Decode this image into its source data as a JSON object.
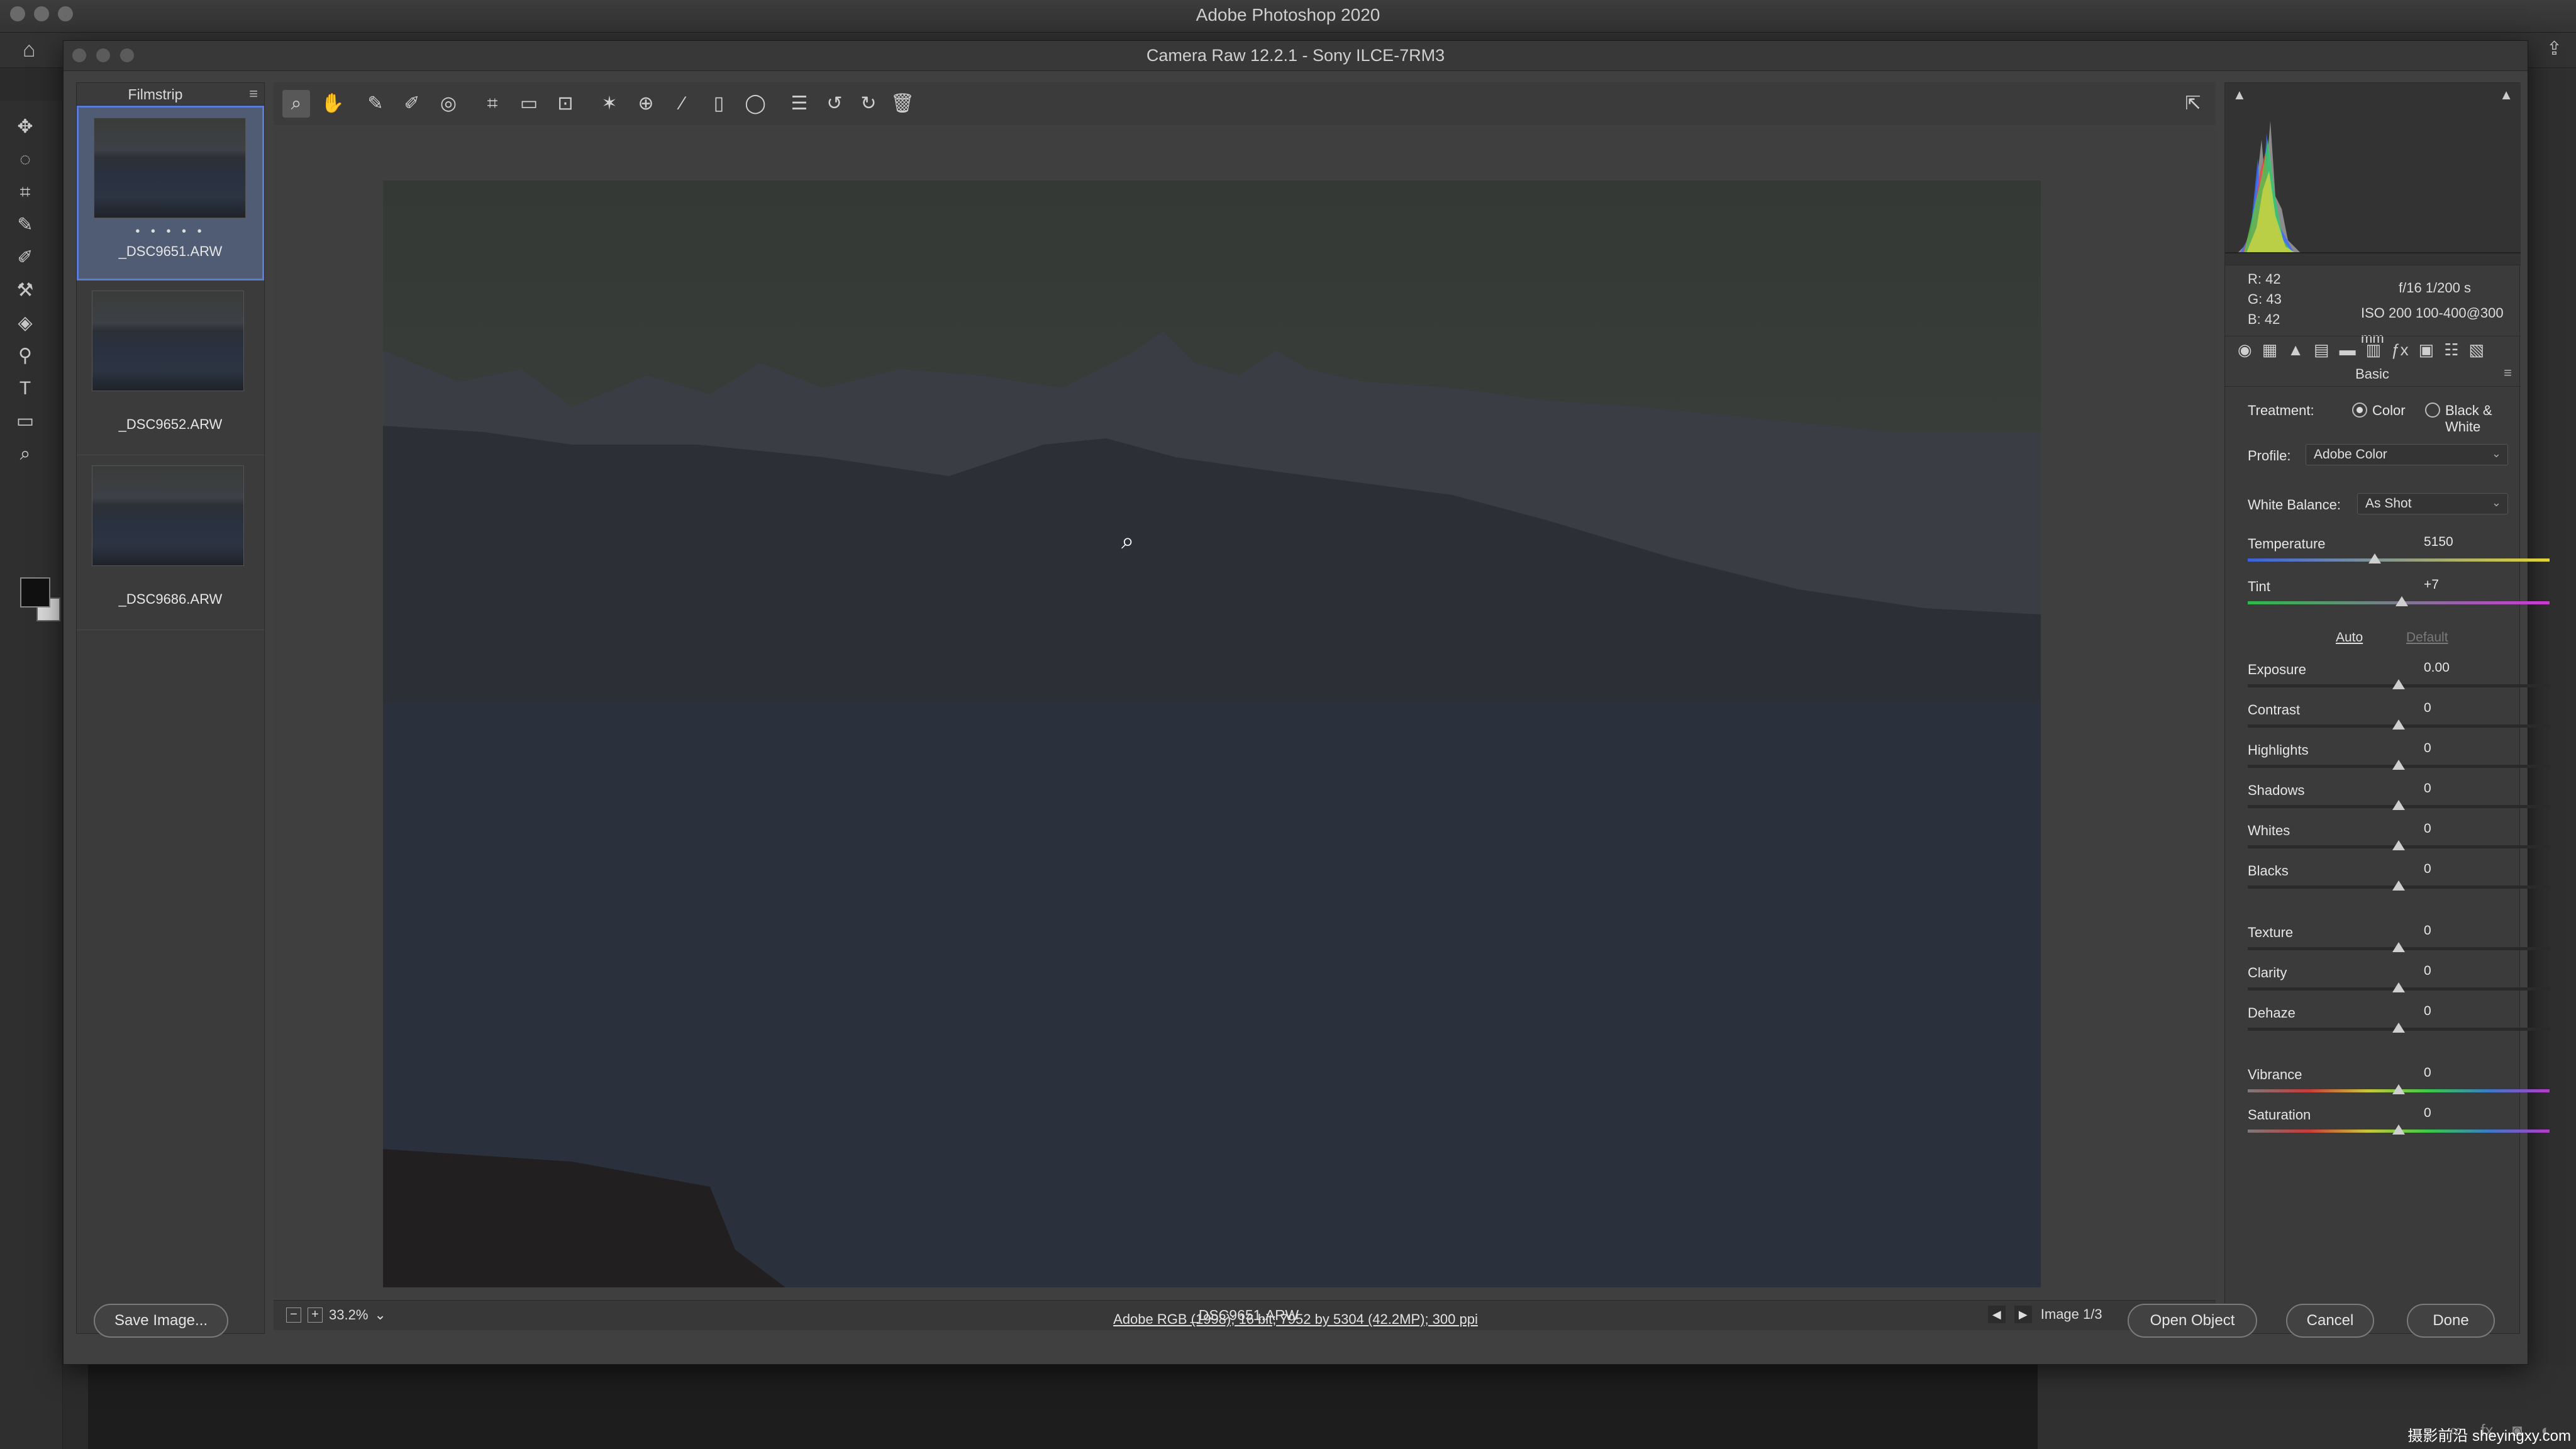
{
  "photoshop": {
    "title": "Adobe Photoshop 2020"
  },
  "dialog": {
    "title": "Camera Raw 12.2.1  -  Sony ILCE-7RM3"
  },
  "filmstrip": {
    "title": "Filmstrip",
    "items": [
      {
        "name": "_DSC9651.ARW",
        "selected": true,
        "rating_dots": "• • • • •"
      },
      {
        "name": "_DSC9652.ARW",
        "selected": false
      },
      {
        "name": "_DSC9686.ARW",
        "selected": false
      }
    ]
  },
  "toolbar": {
    "icons": [
      "zoom-icon",
      "hand-icon",
      "white-balance-icon",
      "color-sampler-icon",
      "targeted-adjust-icon",
      "crop-icon",
      "straighten-icon",
      "transform-icon",
      "spot-removal-icon",
      "red-eye-icon",
      "adjustment-brush-icon",
      "graduated-filter-icon",
      "radial-filter-icon",
      "presets-list-icon",
      "rotate-left-icon",
      "rotate-right-icon",
      "trash-icon"
    ]
  },
  "preview": {
    "zoom": "33.2%",
    "file_name": "_DSC9651.ARW",
    "image_counter": "Image 1/3"
  },
  "histogram_readout": {
    "r": "R:   42",
    "g": "G:   43",
    "b": "B:   42",
    "aperture_shutter": "f/16    1/200 s",
    "iso_lens": "ISO 200    100-400@300 mm"
  },
  "basic_panel": {
    "section_title": "Basic",
    "treatment_label": "Treatment:",
    "treatment_color": "Color",
    "treatment_bw": "Black & White",
    "profile_label": "Profile:",
    "profile_value": "Adobe Color",
    "wb_label": "White Balance:",
    "wb_value": "As Shot",
    "auto_label": "Auto",
    "default_label": "Default",
    "sliders": [
      {
        "label": "Temperature",
        "value": "5150",
        "position": 0.42
      },
      {
        "label": "Tint",
        "value": "+7",
        "position": 0.51
      },
      {
        "label": "Exposure",
        "value": "0.00",
        "position": 0.5
      },
      {
        "label": "Contrast",
        "value": "0",
        "position": 0.5
      },
      {
        "label": "Highlights",
        "value": "0",
        "position": 0.5
      },
      {
        "label": "Shadows",
        "value": "0",
        "position": 0.5
      },
      {
        "label": "Whites",
        "value": "0",
        "position": 0.5
      },
      {
        "label": "Blacks",
        "value": "0",
        "position": 0.5
      },
      {
        "label": "Texture",
        "value": "0",
        "position": 0.5
      },
      {
        "label": "Clarity",
        "value": "0",
        "position": 0.5
      },
      {
        "label": "Dehaze",
        "value": "0",
        "position": 0.5
      },
      {
        "label": "Vibrance",
        "value": "0",
        "position": 0.5
      },
      {
        "label": "Saturation",
        "value": "0",
        "position": 0.5
      }
    ]
  },
  "bottom": {
    "save_image": "Save Image...",
    "workflow_link": "Adobe RGB (1998); 16 bit; 7952 by 5304 (42.2MP); 300 ppi",
    "open_object": "Open Object",
    "cancel": "Cancel",
    "done": "Done"
  },
  "watermark": "摄影前沿 sheyingxy.com",
  "colors": {
    "accent_selection": "#5a7bd6",
    "temperature_gradient": [
      "#3b62d8",
      "#e0d33a"
    ],
    "tint_gradient": [
      "#2fb84a",
      "#c83bd2"
    ]
  }
}
